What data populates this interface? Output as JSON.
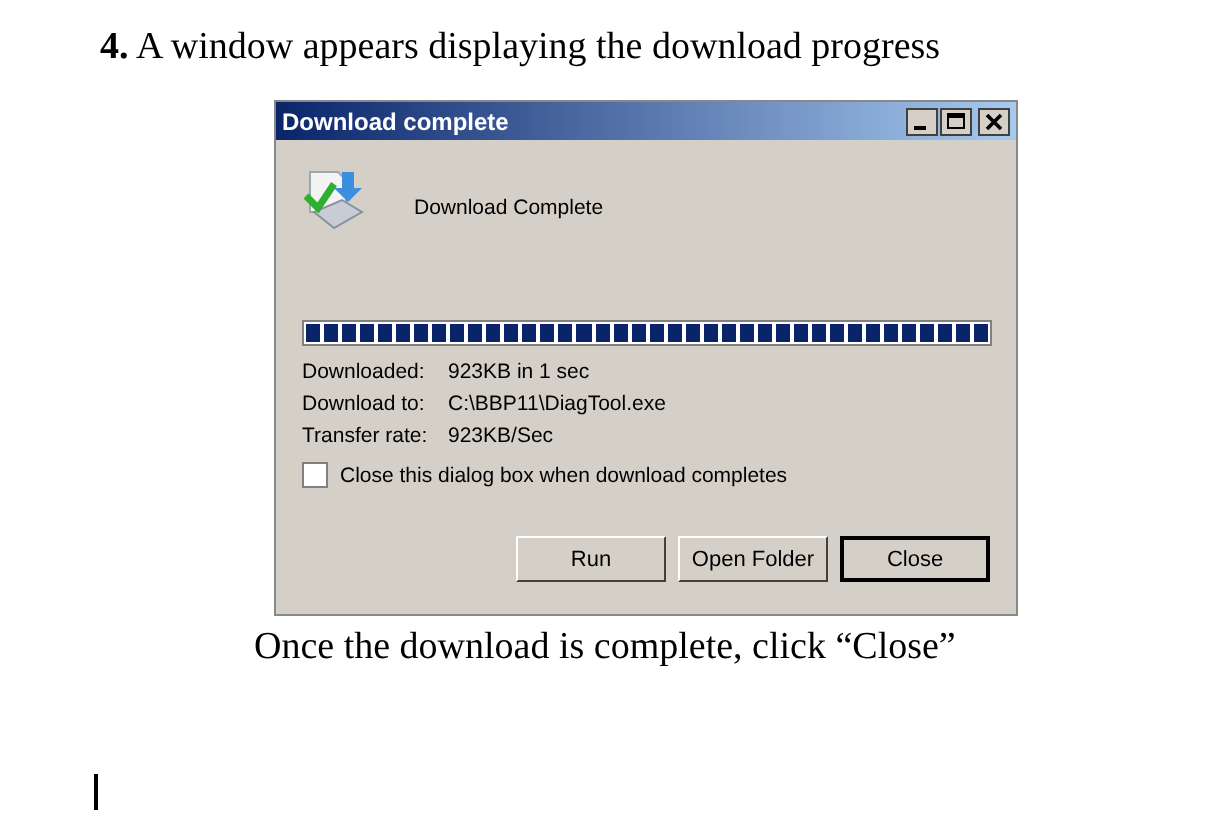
{
  "step_heading": "**4.** A window appears displaying the download progress",
  "dialog": {
    "title": "Download complete",
    "message": "Download Complete",
    "progress": {
      "level": 1
    },
    "details": [
      {
        "label": "Downloaded:",
        "value": "923KB in 1 sec"
      },
      {
        "label": "Download to:",
        "value": "C:\\BBP11\\DiagTool.exe"
      },
      {
        "label": "Transfer rate:",
        "value": "923KB/Sec"
      }
    ],
    "close_when_done": {
      "label": "Close this dialog box when download completes",
      "checked": false
    },
    "buttons": [
      {
        "label": "Run",
        "default": false
      },
      {
        "label": "Open Folder",
        "default": false
      },
      {
        "label": "Close",
        "default": true
      }
    ]
  },
  "caption": "Once the download is complete, click “Close”"
}
